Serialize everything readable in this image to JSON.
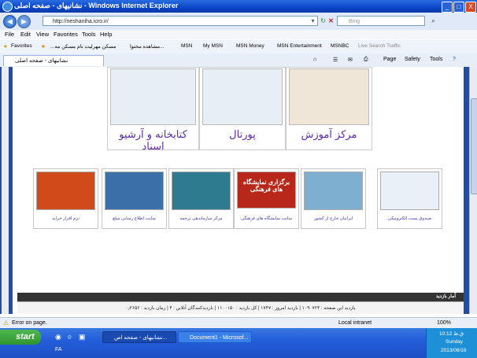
{
  "window": {
    "title": "نشانیهای - صفحه اصلی - Windows Internet Explorer",
    "minimize": "_",
    "maximize": "□",
    "close": "X"
  },
  "address": {
    "url": "http://neshaniha.icro.ir/",
    "search_placeholder": "Bing"
  },
  "menu": [
    "File",
    "Edit",
    "View",
    "Favorites",
    "Tools",
    "Help"
  ],
  "favorites": {
    "label": "Favorites",
    "items": [
      "...مسکن مهرلیت نام مسکن مه",
      "مشاهده محتوا...",
      "MSN",
      "My MSN",
      "MSN Money",
      "MSN Entertainment",
      "MSNBC",
      "Live Search Traffic"
    ]
  },
  "tab": {
    "title": "نشانیهای - صفحه اصلی"
  },
  "commandbar": {
    "page": "Page",
    "safety": "Safety",
    "tools": "Tools"
  },
  "page": {
    "top_links": [
      "کتابخانه و آرشیو اسناد",
      "پورتال",
      "مرکز آموزش"
    ],
    "cards": [
      "نرم افزار جراید",
      "سایت اطلاع رسانی مبلغ",
      "مرکز سازماندهی ترجمه",
      "سایت نمایشگاه های فرهنگی",
      "ایرانیان خارج از کشور",
      "صندوق پست الکترونیکی"
    ],
    "card2_banner": "برگزاری نمایشگاه های فرهنگی",
    "stats_title": "آمار بازدید",
    "stats_line": "بازدید این صفحه : ۱۰۹۰۷۲۴  |  بازدید امروز : ۱۷۴۷  |  کل بازدید : ۱۱۰۰۱۵۰  |  بازدیدکنندگان آنلاین : ۴  |  زمان بازدید : ۰٫۲۶۵۶"
  },
  "status": {
    "left": "Error on page.",
    "zone": "Local intranet",
    "zoom": "100%"
  },
  "taskbar": {
    "start": "start",
    "tasks": [
      "نشانیهای - صفحه اص...",
      "Document1 - Microsof..."
    ],
    "lang": "FA",
    "time_line": "ق.ظ 10:12",
    "day": "Sunday",
    "date": "2013/06/16"
  },
  "colors": {
    "title_blue": "#0a46c8",
    "page_bg": "#1f4ea8",
    "link_purple": "#5a28a8",
    "taskbar_blue": "#245edb"
  }
}
